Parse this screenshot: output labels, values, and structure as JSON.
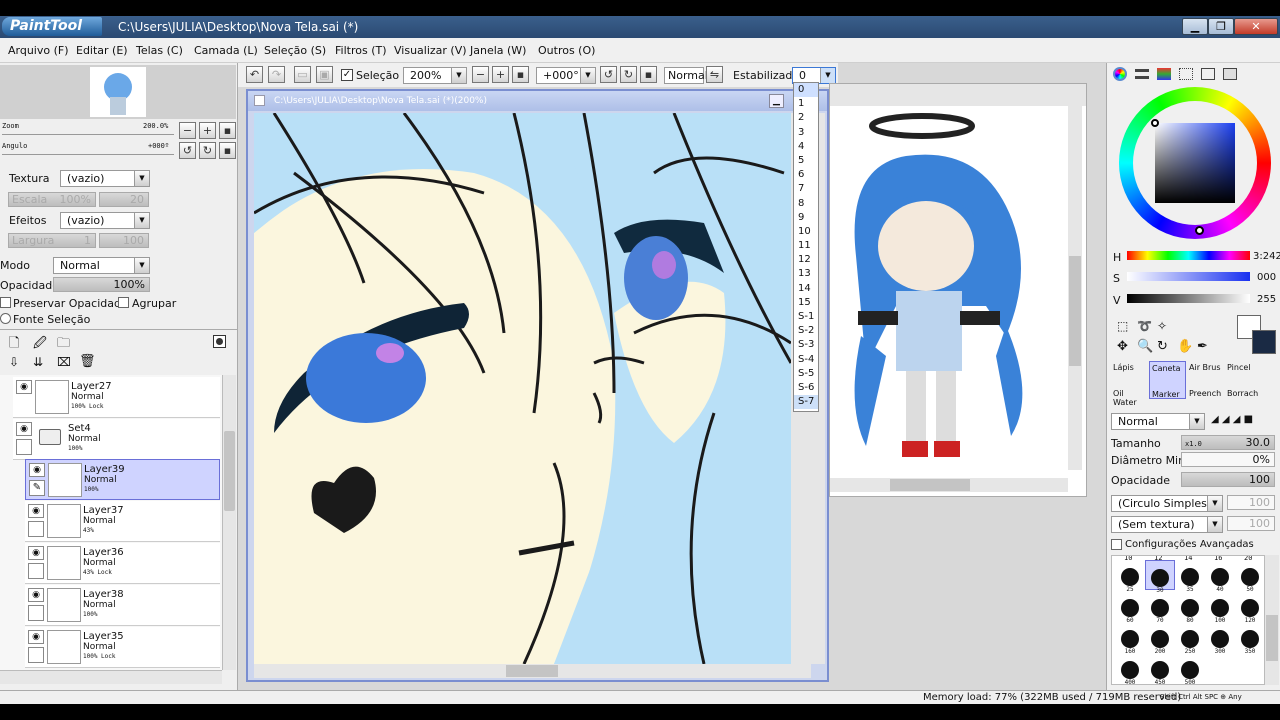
{
  "window": {
    "logo_text": "PaintTool SAI",
    "title": "C:\\Users\\JULIA\\Desktop\\Nova Tela.sai (*)",
    "min": "▁",
    "max": "❐",
    "close": "✕"
  },
  "menu": [
    "Arquivo (F)",
    "Editar (E)",
    "Telas (C)",
    "Camada (L)",
    "Seleção (S)",
    "Filtros (T)",
    "Visualizar (V)",
    "Janela (W)",
    "Outros (O)"
  ],
  "nav": {
    "zoom_label": "Zoom",
    "zoom_value": "200.0%",
    "angle_label": "Angulo",
    "angle_value": "+000º"
  },
  "texture": {
    "label": "Textura",
    "value": "(vazio)",
    "scale_label": "Escala",
    "scale_value": "100%",
    "scale_num": "20"
  },
  "effects": {
    "label": "Efeitos",
    "value": "(vazio)",
    "width_label": "Largura",
    "width_value": "1",
    "width_num": "100"
  },
  "layer_mode": {
    "label": "Modo",
    "value": "Normal"
  },
  "layer_opacity": {
    "label": "Opacidade",
    "value": "100%"
  },
  "checks": {
    "preserve": "Preservar Opacidade",
    "clip": "Agrupar",
    "source": "Fonte Seleção"
  },
  "layers": [
    {
      "name": "Layer27",
      "mode": "Normal",
      "opacity": "100% Lock",
      "type": "layer"
    },
    {
      "name": "Set4",
      "mode": "Normal",
      "opacity": "100%",
      "type": "folder"
    },
    {
      "name": "Layer39",
      "mode": "Normal",
      "opacity": "100%",
      "type": "layer",
      "selected": true
    },
    {
      "name": "Layer37",
      "mode": "Normal",
      "opacity": "43%",
      "type": "layer"
    },
    {
      "name": "Layer36",
      "mode": "Normal",
      "opacity": "43% Lock",
      "type": "layer"
    },
    {
      "name": "Layer38",
      "mode": "Normal",
      "opacity": "100%",
      "type": "layer"
    },
    {
      "name": "Layer35",
      "mode": "Normal",
      "opacity": "100% Lock",
      "type": "layer"
    }
  ],
  "canvas_toolbar": {
    "selection_label": "Seleção",
    "zoom": "200%",
    "rotation": "+000°",
    "blend": "Normal",
    "stabilizer_label": "Estabilizador",
    "stabilizer_value": "0"
  },
  "canvas_window": {
    "title": "C:\\Users\\JULIA\\Desktop\\Nova Tela.sai (*)(200%)"
  },
  "stabilizer_options": [
    "0",
    "1",
    "2",
    "3",
    "4",
    "5",
    "6",
    "7",
    "8",
    "9",
    "10",
    "11",
    "12",
    "13",
    "14",
    "15",
    "S-1",
    "S-2",
    "S-3",
    "S-4",
    "S-5",
    "S-6",
    "S-7"
  ],
  "color": {
    "h_label": "H",
    "h_value": "3:242",
    "s_label": "S",
    "s_value": "000",
    "v_label": "V",
    "v_value": "255",
    "primary": "#ffffff",
    "secondary": "#1a2a44"
  },
  "tools": {
    "row1": [
      "Lápis",
      "Caneta",
      "Air Brus",
      "Pincel"
    ],
    "row2": [
      "Oil Water",
      "Marker",
      "Preench",
      "Borrach"
    ]
  },
  "brush": {
    "mode": "Normal",
    "size_label": "Tamanho",
    "size_mult": "x1.0",
    "size_value": "30.0",
    "min_label": "Diâmetro Min.",
    "min_value": "0%",
    "opacity_label": "Opacidade",
    "opacity_value": "100",
    "shape": "(Circulo Simples)",
    "texture": "(Sem textura)",
    "shape_num": "100",
    "texture_num": "100",
    "advanced": "Configurações Avançadas"
  },
  "brush_sizes": [
    "25",
    "30",
    "35",
    "40",
    "50",
    "60",
    "70",
    "80",
    "100",
    "120",
    "160",
    "200",
    "250",
    "300",
    "350",
    "400",
    "450",
    "500"
  ],
  "brush_top": [
    "10",
    "12",
    "14",
    "16",
    "20"
  ],
  "status": {
    "memory": "Memory load: 77% (322MB used / 719MB reserved)",
    "keys": "Shift Ctrl Alt SPC ⊕ Any"
  }
}
